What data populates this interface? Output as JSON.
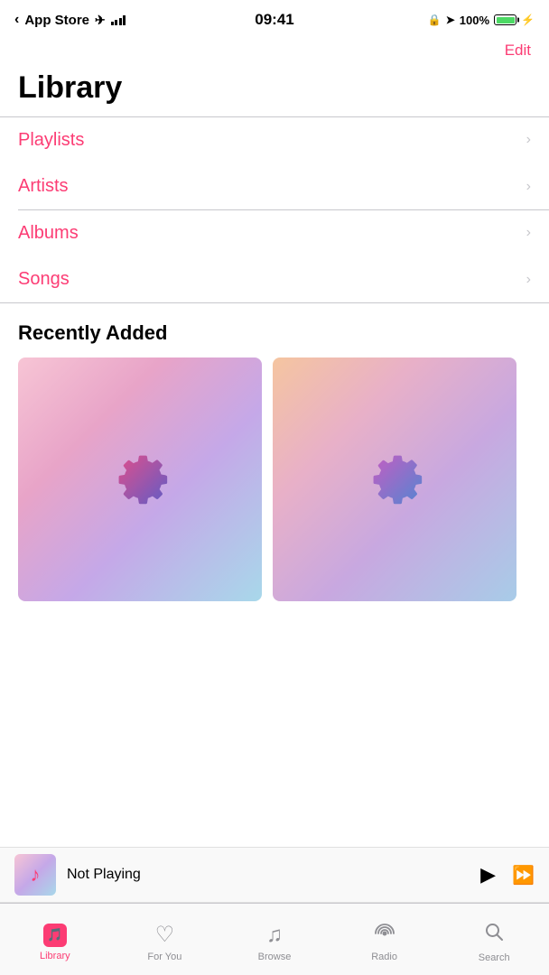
{
  "statusBar": {
    "backText": "App Store",
    "time": "09:41",
    "batteryPercent": "100%"
  },
  "header": {
    "editLabel": "Edit",
    "title": "Library"
  },
  "menuItems": [
    {
      "label": "Playlists"
    },
    {
      "label": "Artists"
    },
    {
      "label": "Albums"
    },
    {
      "label": "Songs"
    }
  ],
  "recentlyAdded": {
    "sectionTitle": "Recently Added",
    "albums": [
      {
        "bg": "pink"
      },
      {
        "bg": "orange"
      }
    ]
  },
  "miniPlayer": {
    "title": "Not Playing"
  },
  "tabBar": {
    "items": [
      {
        "label": "Library",
        "active": true
      },
      {
        "label": "For You",
        "active": false
      },
      {
        "label": "Browse",
        "active": false
      },
      {
        "label": "Radio",
        "active": false
      },
      {
        "label": "Search",
        "active": false
      }
    ]
  }
}
